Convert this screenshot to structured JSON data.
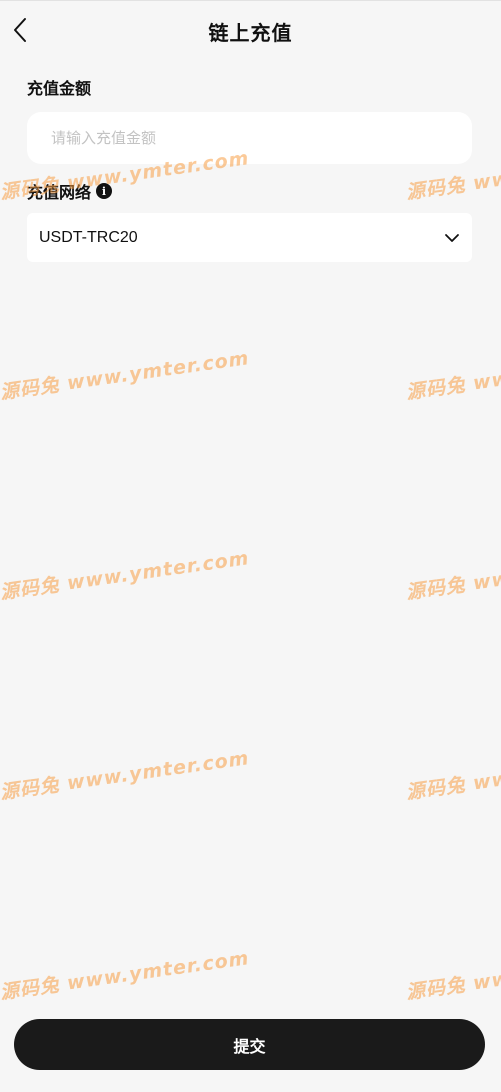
{
  "header": {
    "title": "链上充值",
    "back_icon": "chevron-left-icon"
  },
  "amount": {
    "label": "充值金额",
    "placeholder": "请输入充值金额",
    "value": ""
  },
  "network": {
    "label": "充值网络",
    "info_icon": "info-icon",
    "info_glyph": "i",
    "selected": "USDT-TRC20",
    "dropdown_icon": "chevron-down-icon"
  },
  "submit": {
    "label": "提交"
  },
  "watermark": {
    "text_left": "源码兔 www.ymter.com",
    "text_right": "源码兔 www",
    "color": "#f79e46"
  }
}
